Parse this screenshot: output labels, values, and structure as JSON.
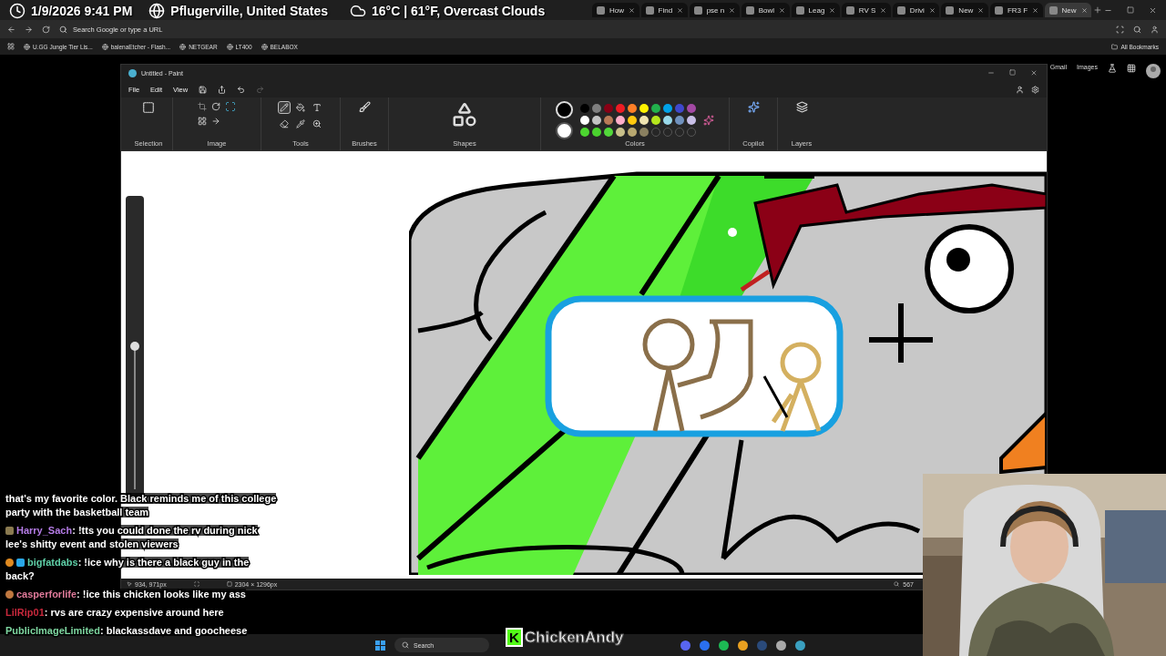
{
  "overlay": {
    "date_time": "1/9/2026 9:41 PM",
    "location": "Pflugerville, United States",
    "weather": "16°C | 61°F, Overcast Clouds"
  },
  "browser": {
    "tabs": [
      {
        "label": "How",
        "selected": false
      },
      {
        "label": "Find",
        "selected": false
      },
      {
        "label": "pse n",
        "selected": false
      },
      {
        "label": "Bowl",
        "selected": false
      },
      {
        "label": "Leag",
        "selected": false
      },
      {
        "label": "RV S",
        "selected": false
      },
      {
        "label": "Drivi",
        "selected": false
      },
      {
        "label": "New",
        "selected": false
      },
      {
        "label": "FR3 F",
        "selected": false
      },
      {
        "label": "New",
        "selected": true
      }
    ],
    "address_placeholder": "Search Google or type a URL",
    "bookmarks": [
      "U.GG Jungle Tier Lis...",
      "balenaEtcher - Flash...",
      "NETGEAR",
      "LT400",
      "BELABOX"
    ],
    "all_bookmarks": "All Bookmarks",
    "page_links": [
      "Gmail",
      "Images"
    ]
  },
  "paint": {
    "title": "Untitled - Paint",
    "menu": [
      "File",
      "Edit",
      "View"
    ],
    "ribbon_groups": [
      "Selection",
      "Image",
      "Tools",
      "Brushes",
      "Shapes",
      "Colors",
      "Copilot",
      "Layers"
    ],
    "tools": [
      {
        "kind": "pencil",
        "selected": true
      },
      {
        "kind": "fill",
        "selected": false
      },
      {
        "kind": "text",
        "selected": false
      },
      {
        "kind": "eraser",
        "selected": false
      },
      {
        "kind": "picker",
        "selected": false
      },
      {
        "kind": "magnifier",
        "selected": false
      }
    ],
    "palette": [
      {
        "color": "#000000"
      },
      {
        "color": "#7f7f7f"
      },
      {
        "color": "#880015"
      },
      {
        "color": "#ed1c24"
      },
      {
        "color": "#ff7f27"
      },
      {
        "color": "#fff200"
      },
      {
        "color": "#22b14c"
      },
      {
        "color": "#00a2e8"
      },
      {
        "color": "#3f48cc"
      },
      {
        "color": "#a349a4"
      },
      {
        "color": "#ffffff"
      },
      {
        "color": "#c3c3c3"
      },
      {
        "color": "#b97a57"
      },
      {
        "color": "#ffaec9"
      },
      {
        "color": "#ffc90e"
      },
      {
        "color": "#efe4b0"
      },
      {
        "color": "#b5e61d"
      },
      {
        "color": "#99d9ea"
      },
      {
        "color": "#7092be"
      },
      {
        "color": "#c8bfe7"
      },
      {
        "color": "#4cd630"
      },
      {
        "color": "#4ad22e"
      },
      {
        "color": "#52d83a"
      },
      {
        "color": "#c8c08a"
      },
      {
        "color": "#b8a870"
      },
      {
        "color": "#8a8060"
      }
    ],
    "zoom_slider": {
      "level": 0.5
    },
    "status": {
      "cursor": "934, 971px",
      "size": "2304 × 1296px",
      "zoom": "567"
    }
  },
  "chat": [
    {
      "text": "that's my favorite color. Black reminds me of this college party with the basketball team"
    },
    {
      "user": "Harry_Sach",
      "separator": ":",
      "color": "#b57ce6",
      "badges": [
        {
          "kind": "book"
        }
      ],
      "text": "!tts you could done the rv during nick lee's shitty event and stolen viewers"
    },
    {
      "user": "bigfatdabs",
      "separator": ":",
      "color": "#5fd0a8",
      "badges": [
        {
          "kind": "pumpkin"
        },
        {
          "kind": "cube"
        }
      ],
      "text": "!ice why is there a black guy in the back?"
    },
    {
      "user": "casperforlife",
      "separator": ":",
      "color": "#e07a9a",
      "badges": [
        {
          "kind": "drumstick"
        }
      ],
      "text": "!ice this chicken looks like my ass"
    },
    {
      "user": "LilRip01",
      "separator": ":",
      "color": "#c8283c",
      "text": "rvs are crazy expensive around here"
    },
    {
      "user": "PublicImageLimited",
      "separator": ":",
      "color": "#7ed6a0",
      "text": "blackassdave and goocheese"
    }
  ],
  "taskbar": {
    "search_placeholder": "Search"
  },
  "streamer_logo": {
    "badge": "K",
    "name": "ChickenAndy"
  }
}
